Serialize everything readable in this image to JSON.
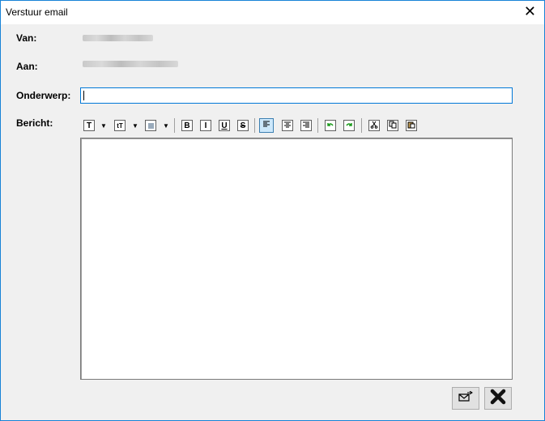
{
  "window": {
    "title": "Verstuur email"
  },
  "labels": {
    "from": "Van:",
    "to": "Aan:",
    "subject": "Onderwerp:",
    "message": "Bericht:"
  },
  "fields": {
    "subject_value": "",
    "message_value": ""
  },
  "toolbar": {
    "font_icon": "T",
    "font_size_icon": "tT",
    "bold": "B",
    "italic": "I",
    "underline": "U",
    "strike": "S"
  },
  "icons": [
    "close-icon",
    "send-icon",
    "cancel-icon",
    "align-left-icon",
    "align-center-icon",
    "align-right-icon",
    "undo-icon",
    "redo-icon",
    "cut-icon",
    "copy-icon",
    "paste-icon",
    "color-icon"
  ]
}
